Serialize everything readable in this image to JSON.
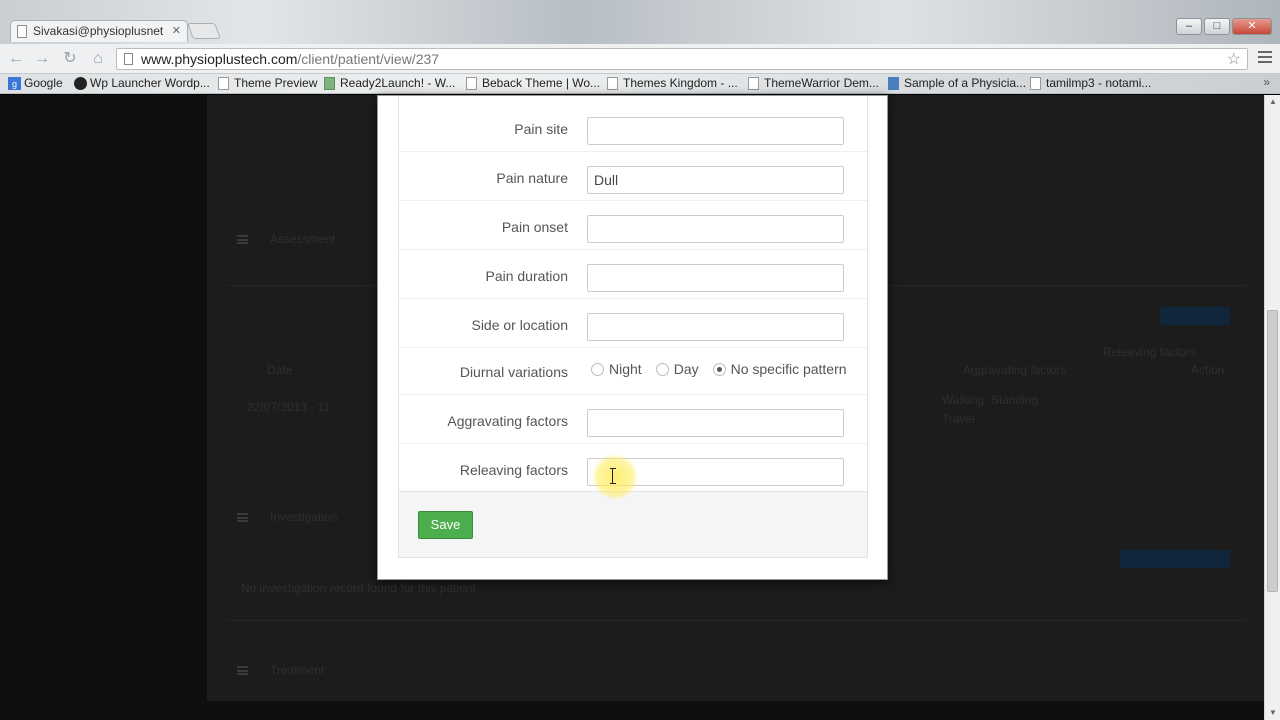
{
  "browser": {
    "tab_title": "Sivakasi@physioplusnet",
    "url_domain": "www.physioplustech.com",
    "url_path": "/client/patient/view/237",
    "bookmarks": [
      {
        "label": "Google",
        "icon": "google-icon"
      },
      {
        "label": "Wp Launcher Wordp...",
        "icon": "wordpress-icon"
      },
      {
        "label": "Theme Preview",
        "icon": "page-icon"
      },
      {
        "label": "Ready2Launch! - W...",
        "icon": "image-icon"
      },
      {
        "label": "Beback Theme | Wo...",
        "icon": "page-icon"
      },
      {
        "label": "Themes Kingdom - ...",
        "icon": "page-icon"
      },
      {
        "label": "ThemeWarrior Dem...",
        "icon": "page-icon"
      },
      {
        "label": "Sample of a Physicia...",
        "icon": "ship-icon"
      },
      {
        "label": "tamilmp3 - notami...",
        "icon": "page-icon"
      }
    ],
    "bookmarks_more": "»"
  },
  "background": {
    "section_assessment": "Assessment",
    "section_investigation": "Investigation",
    "section_treatment": "Treatment",
    "no_investigation": "No investigation record found for this patient",
    "row_date": "22/07/2013 - 11",
    "row_factors": "Walking, Standing, Travel",
    "col_date": "Date",
    "col_aggravating": "Aggravating factors",
    "col_releaving": "Releaving factors",
    "col_action": "Action"
  },
  "form": {
    "fields": [
      {
        "label": "Pain site",
        "value": ""
      },
      {
        "label": "Pain nature",
        "value": "Dull"
      },
      {
        "label": "Pain onset",
        "value": ""
      },
      {
        "label": "Pain duration",
        "value": ""
      },
      {
        "label": "Side or location",
        "value": ""
      }
    ],
    "diurnal": {
      "label": "Diurnal variations",
      "options": [
        "Night",
        "Day",
        "No specific pattern"
      ],
      "selected": "No specific pattern"
    },
    "aggravating": {
      "label": "Aggravating factors",
      "value": ""
    },
    "releaving": {
      "label": "Releaving factors",
      "value": ""
    },
    "save_label": "Save"
  },
  "colors": {
    "save_button": "#4cae4c",
    "overlay": "#1c1c1c"
  }
}
